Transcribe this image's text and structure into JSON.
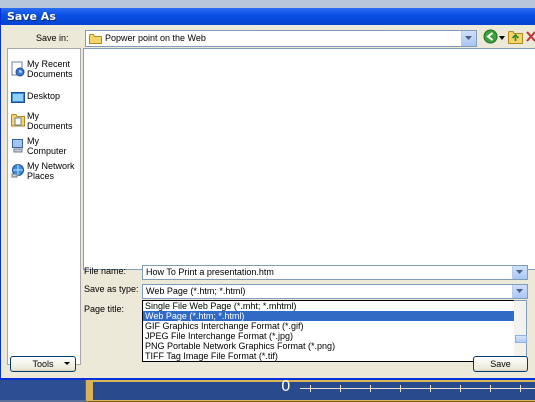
{
  "dialog": {
    "title": "Save As"
  },
  "save_in": {
    "label": "Save in:",
    "value": "Popwer point on the Web"
  },
  "places": [
    {
      "label": "My Recent Documents",
      "icon": "recent-documents-icon"
    },
    {
      "label": "Desktop",
      "icon": "desktop-icon"
    },
    {
      "label": "My Documents",
      "icon": "my-documents-icon"
    },
    {
      "label": "My Computer",
      "icon": "my-computer-icon"
    },
    {
      "label": "My Network Places",
      "icon": "network-places-icon"
    }
  ],
  "file_name": {
    "label": "File name:",
    "value": "How To Print a presentation.htm"
  },
  "save_as_type": {
    "label": "Save as type:",
    "value": "Web Page (*.htm; *.html)",
    "options": [
      "Single File Web Page (*.mht; *.mhtml)",
      "Web Page (*.htm; *.html)",
      "GIF Graphics Interchange Format (*.gif)",
      "JPEG File Interchange Format (*.jpg)",
      "PNG Portable Network Graphics Format (*.png)",
      "TIFF Tag Image File Format (*.tif)"
    ],
    "selected_index": 1
  },
  "page_title": {
    "label": "Page title:"
  },
  "buttons": {
    "tools": "Tools",
    "save": "Save"
  },
  "background": {
    "ruler_zero": "0"
  },
  "colors": {
    "title_bar": "#0a4fe3",
    "dialog_face": "#ece9d8",
    "selection": "#316ac5"
  }
}
